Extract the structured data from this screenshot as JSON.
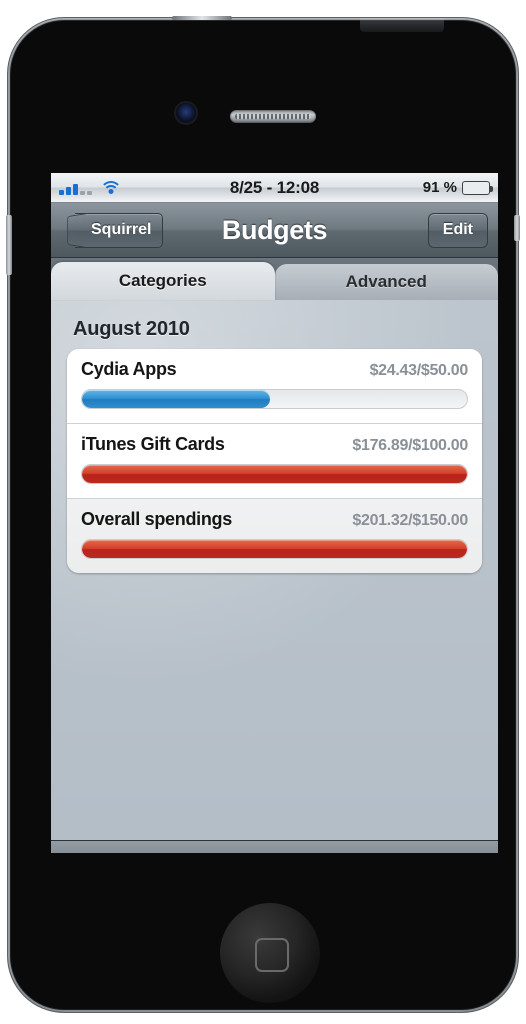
{
  "status_bar": {
    "signal_bars_filled": 3,
    "signal_bars_total": 5,
    "wifi_icon": "wifi-icon",
    "time": "8/25 - 12:08",
    "battery_percent": "91 %",
    "battery_level": 91
  },
  "nav": {
    "back_label": "Squirrel",
    "title": "Budgets",
    "edit_label": "Edit"
  },
  "tabs": [
    {
      "label": "Categories",
      "active": true
    },
    {
      "label": "Advanced",
      "active": false
    }
  ],
  "content": {
    "section_title": "August 2010",
    "budgets": [
      {
        "name": "Cydia Apps",
        "amount": "$24.43/$50.00",
        "spent": 24.43,
        "limit": 50.0,
        "percent": 48.9,
        "bar_color": "#2e8fd1",
        "over_budget": false
      },
      {
        "name": "iTunes Gift Cards",
        "amount": "$176.89/$100.00",
        "spent": 176.89,
        "limit": 100.0,
        "percent": 100,
        "bar_color": "#c6301f",
        "over_budget": true
      },
      {
        "name": "Overall spendings",
        "amount": "$201.32/$150.00",
        "spent": 201.32,
        "limit": 150.0,
        "percent": 100,
        "bar_color": "#c6301f",
        "over_budget": true
      }
    ]
  },
  "toolbar": {
    "add_icon": "plus-icon"
  }
}
